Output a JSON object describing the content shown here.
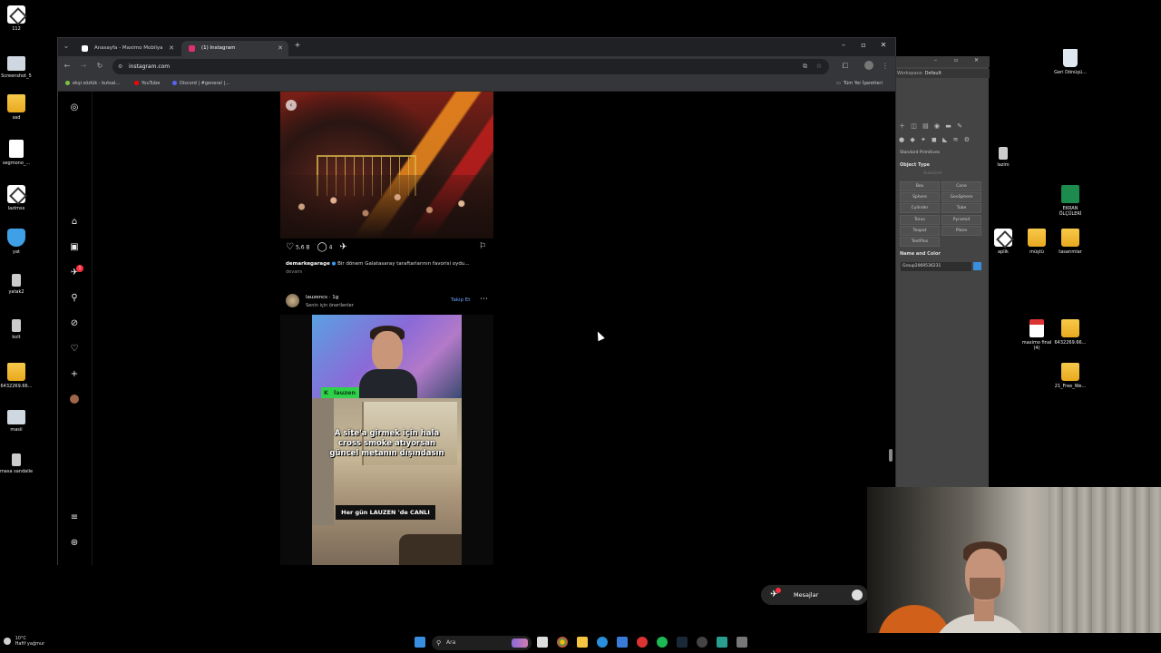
{
  "desktop": {
    "left_icons": [
      {
        "label": "112",
        "type": "cube"
      },
      {
        "label": "Screenshot_5",
        "type": "pc"
      },
      {
        "label": "sad",
        "type": "folder"
      },
      {
        "label": "segmono_...",
        "type": "doc"
      },
      {
        "label": "lazimss",
        "type": "cube"
      },
      {
        "label": "yat",
        "type": "shield"
      },
      {
        "label": "yatak2",
        "type": "small"
      },
      {
        "label": "kolt",
        "type": "small"
      },
      {
        "label": "6432269.66...",
        "type": "folder"
      },
      {
        "label": "masii",
        "type": "pc"
      },
      {
        "label": "masa sandalie",
        "type": "small"
      }
    ],
    "right_icons": [
      {
        "label": "Geri Dönüşü...",
        "type": "bin"
      },
      {
        "label": "lazim",
        "type": "small"
      },
      {
        "label": "EKRAN ÖLÇÜLERİ",
        "type": "excel"
      },
      {
        "label": "aplik",
        "type": "cube"
      },
      {
        "label": "müştü",
        "type": "folder"
      },
      {
        "label": "tasarımlar",
        "type": "folder"
      },
      {
        "label": "maximo final (4)",
        "type": "pdf"
      },
      {
        "label": "6432269.66...",
        "type": "folder"
      },
      {
        "label": "21_Free_We...",
        "type": "folder"
      }
    ]
  },
  "browser": {
    "tabs": [
      {
        "label": "Anasayfa - Maximo Mobilya",
        "active": false,
        "color": "#ffffff"
      },
      {
        "label": "(1) Instagram",
        "active": true,
        "color": "#e1306c"
      }
    ],
    "new_tab": "+",
    "url": "instagram.com",
    "bookmarks": [
      {
        "label": "ekşi sözlük - kutsal...",
        "color": "#7ac142"
      },
      {
        "label": "YouTube",
        "color": "#ff0000"
      },
      {
        "label": "Discord | #general |...",
        "color": "#5865f2"
      }
    ],
    "all_bookmarks": "Tüm Yer İşaretleri"
  },
  "instagram": {
    "notification_count": "1",
    "post1": {
      "likes": "5,6 B",
      "comments": "4",
      "caption_user": "demarkegarage",
      "caption_text": "Bir dönem Galatasaray taraftarlarının favorisi oydu...",
      "more": "devamı"
    },
    "post2": {
      "username": "lauzencs",
      "time": "1g",
      "subtitle": "Senin için önerilenler",
      "follow": "Takip Et",
      "video_tag": "lauzen",
      "video_title_lines": [
        "A site'a girmek için hala",
        "cross smoke atıyorsan",
        "güncel metanın dışındasın"
      ],
      "video_banner": "Her gün  LAUZEN 'de CANLI"
    },
    "messages_label": "Mesajlar"
  },
  "max_panel": {
    "workspace_label": "Workspace:",
    "workspace_value": "Default",
    "dropdown": "Standard Primitives",
    "object_type_header": "Object Type",
    "autogrid": "AutoGrid",
    "buttons": [
      "Box",
      "Cone",
      "Sphere",
      "GeoSphere",
      "Cylinder",
      "Tube",
      "Torus",
      "Pyramid",
      "Teapot",
      "Plane",
      "TextPlus"
    ],
    "name_color_header": "Name and Color",
    "object_name": "Group2069536231"
  },
  "taskbar": {
    "temperature": "10°C",
    "weather": "Hafif yağmur",
    "search_placeholder": "Ara"
  }
}
